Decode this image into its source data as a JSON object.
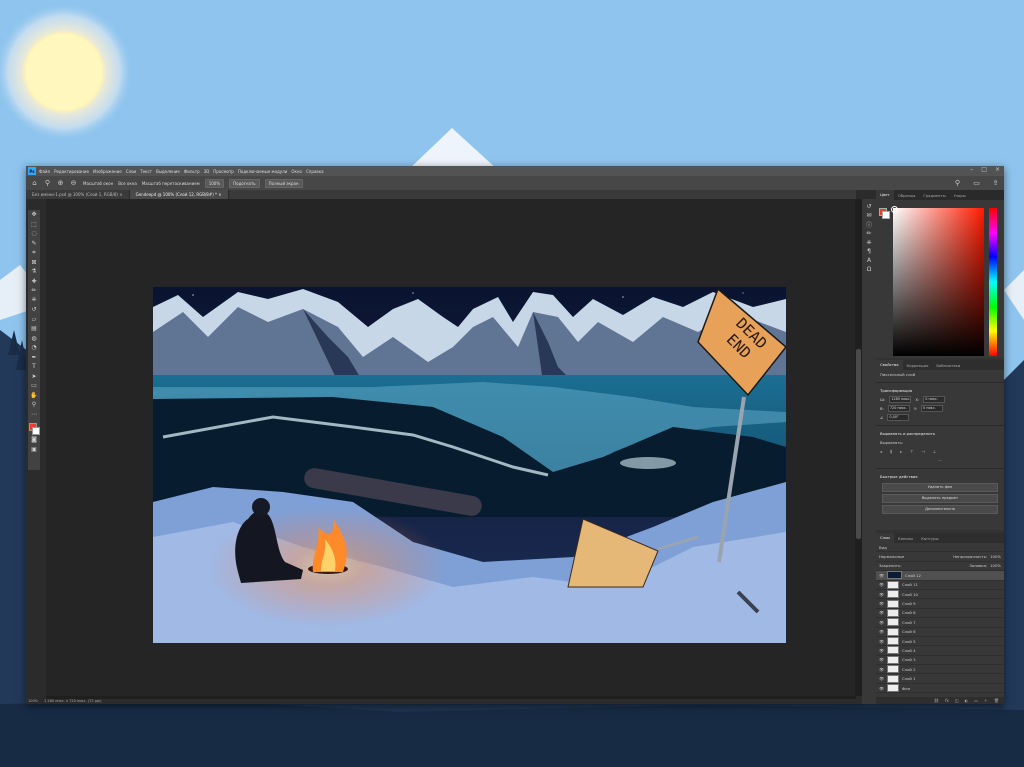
{
  "menubar": {
    "logo": "Ps",
    "items": [
      "Файл",
      "Редактирование",
      "Изображение",
      "Слои",
      "Текст",
      "Выделение",
      "Фильтр",
      "3D",
      "Просмотр",
      "Подключаемые модули",
      "Окно",
      "Справка"
    ]
  },
  "optionbar": {
    "items": [
      "Масштаб окон",
      "Все окна",
      "Масштаб перетаскиванием",
      "100%",
      "Подогнать",
      "Полный экран"
    ]
  },
  "tabs": [
    {
      "label": "Без имени-1.psd @ 100% (Слой 1, RGB/8) ×"
    },
    {
      "label": "Gendeepd @ 100% (Слой 12, RGB/8#) * ×"
    }
  ],
  "status": {
    "zoom": "100%",
    "doc": "1 280 пикс. x 720 пикс. (72 ppi)"
  },
  "panels": {
    "color_tabs": [
      "Цвет",
      "Образцы",
      "Градиенты",
      "Узоры"
    ],
    "colors": {
      "foreground": "#e84030",
      "background": "#ffffff",
      "accent": "#31a8ff"
    },
    "props_tabs": [
      "Свойства",
      "Коррекция",
      "Библиотеки"
    ],
    "props": {
      "doc_label": "Пиксельный слой",
      "transform_label": "Трансформация",
      "w": "1280 пикс.",
      "h": "720 пикс.",
      "x": "0 пикс.",
      "y": "0 пикс.",
      "angle": "0,00°",
      "align_label": "Выровнять и распределить",
      "align_sub": "Выровнять:",
      "quick_label": "Быстрые действия",
      "btn1": "Удалить фон",
      "btn2": "Выделить предмет",
      "more": "Дополнительно"
    },
    "layers_tabs": [
      "Слои",
      "Каналы",
      "Контуры"
    ],
    "layers": {
      "kind": "Вид",
      "blend": "Нормальные",
      "opacity_label": "Непрозрачность:",
      "opacity": "100%",
      "lock_label": "Закрепить:",
      "fill_label": "Заливка:",
      "fill": "100%",
      "items": [
        "Слой 12",
        "Слой 11",
        "Слой 10",
        "Слой 9",
        "Слой 8",
        "Слой 7",
        "Слой 6",
        "Слой 5",
        "Слой 4",
        "Слой 3",
        "Слой 2",
        "Слой 1",
        "Фон"
      ]
    }
  },
  "photo_sign": {
    "line1": "DEAD",
    "line2": "END"
  }
}
